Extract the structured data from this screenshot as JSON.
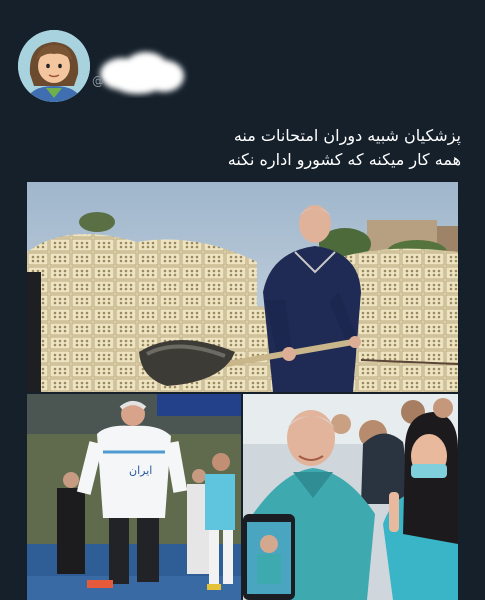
{
  "tweet": {
    "author": {
      "avatar_icon": "cartoon-woman-avatar-icon",
      "name_redacted": true,
      "handle_prefix": "@"
    },
    "text_lines": [
      "پزشکیان شبیه دوران امتحانات منه",
      "همه کار میکنه که کشورو اداره نکنه"
    ],
    "media": {
      "photos": [
        {
          "description_icon": "man-shoveling-bricks-photo"
        },
        {
          "description_icon": "man-playing-futsal-photo"
        },
        {
          "description_icon": "man-in-scrubs-with-nurse-photo"
        }
      ],
      "jersey_text": "ايران"
    }
  },
  "colors": {
    "background": "#15202b",
    "text": "#ffffff",
    "muted": "#8b98a5"
  }
}
